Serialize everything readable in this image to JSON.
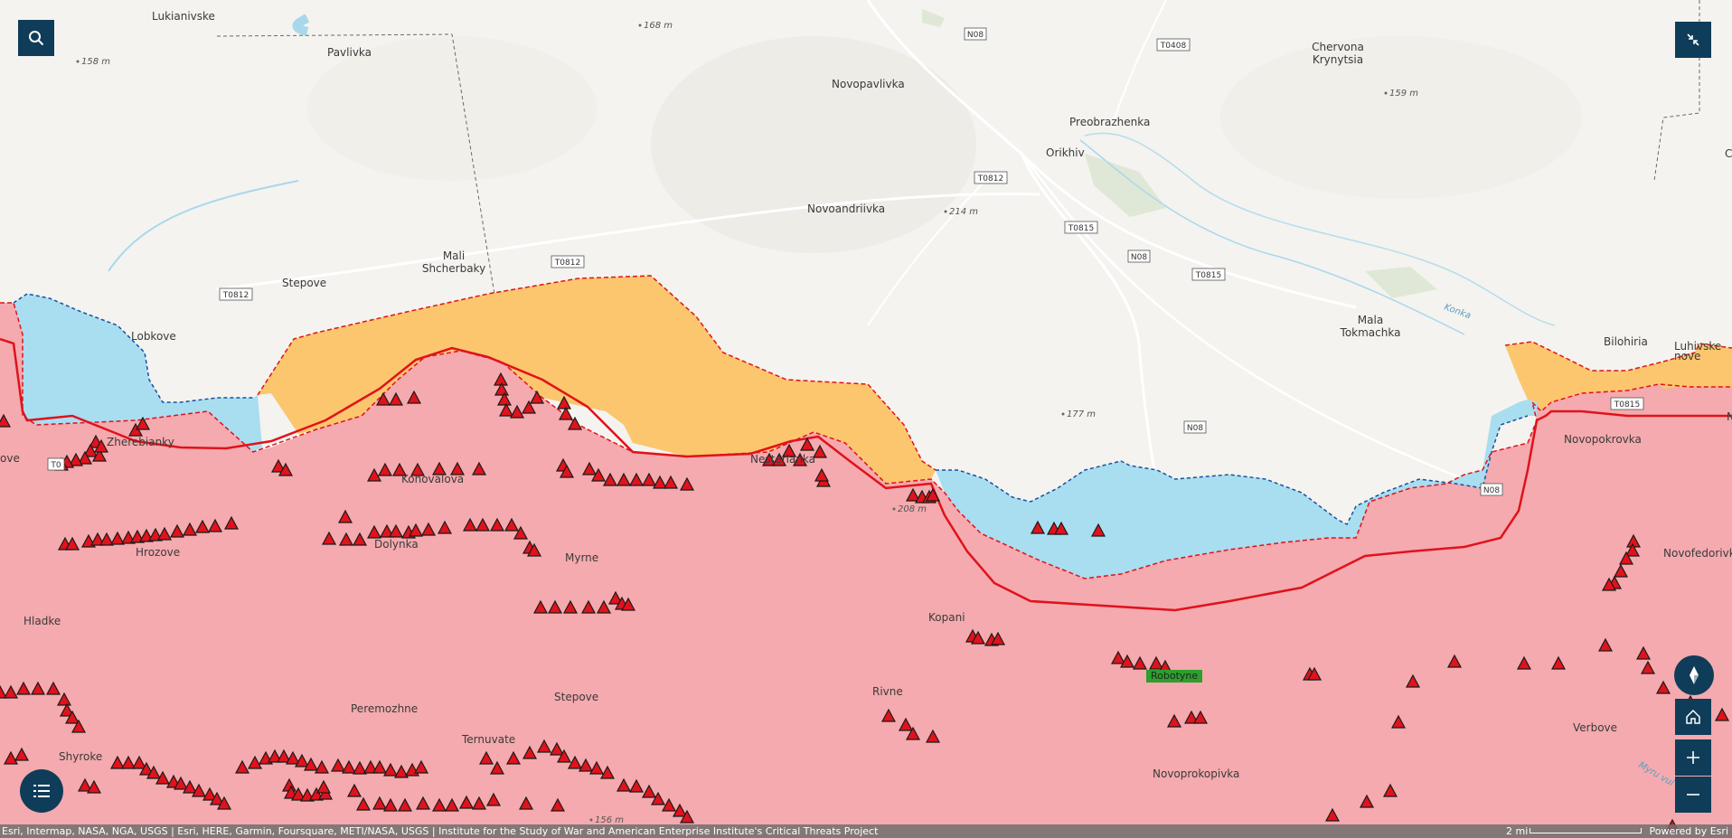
{
  "colors": {
    "occupied": "#f4aaae",
    "contested_orange": "#fbc66d",
    "contested_blue": "#a8def0",
    "frontline": "#e0121c",
    "control_bg": "#0f3d59"
  },
  "places": [
    {
      "id": "lukianivske",
      "name": "Lukianivske"
    },
    {
      "id": "pavlivka",
      "name": "Pavlivka"
    },
    {
      "id": "novopavlivka",
      "name": "Novopavlivka"
    },
    {
      "id": "chervona",
      "name": "Chervona\nKrynytsia"
    },
    {
      "id": "preobrazhenka",
      "name": "Preobrazhenka"
    },
    {
      "id": "orikhiv",
      "name": "Orikhiv"
    },
    {
      "id": "novoandriivka",
      "name": "Novoandriivka"
    },
    {
      "id": "mali",
      "name": "Mali\nShcherbaky"
    },
    {
      "id": "stepove1",
      "name": "Stepove"
    },
    {
      "id": "lobkove",
      "name": "Lobkove"
    },
    {
      "id": "mala",
      "name": "Mala\nTokmachka"
    },
    {
      "id": "bilohiria",
      "name": "Bilohiria"
    },
    {
      "id": "luhivske",
      "name": "Luhivske"
    },
    {
      "id": "zherebianky",
      "name": "Zherebianky"
    },
    {
      "id": "konovalova",
      "name": "Konovalova"
    },
    {
      "id": "nesterianka",
      "name": "Nesterianka"
    },
    {
      "id": "novopokrovka",
      "name": "Novopokrovka"
    },
    {
      "id": "dolynka",
      "name": "Dolynka"
    },
    {
      "id": "hrozove",
      "name": "Hrozove"
    },
    {
      "id": "myrne",
      "name": "Myrne"
    },
    {
      "id": "novofedorivka",
      "name": "Novofedorivka"
    },
    {
      "id": "hladke",
      "name": "Hladke"
    },
    {
      "id": "kopani",
      "name": "Kopani"
    },
    {
      "id": "peremozhne",
      "name": "Peremozhne"
    },
    {
      "id": "stepove2",
      "name": "Stepove"
    },
    {
      "id": "rivne",
      "name": "Rivne"
    },
    {
      "id": "verbove",
      "name": "Verbove"
    },
    {
      "id": "shyroke",
      "name": "Shyroke"
    },
    {
      "id": "ternuvate",
      "name": "Ternuvate"
    },
    {
      "id": "novoprokopivka",
      "name": "Novoprokopivka"
    },
    {
      "id": "ove",
      "name": "ove"
    },
    {
      "id": "nove",
      "name": "nove"
    },
    {
      "id": "edge_c",
      "name": "C"
    },
    {
      "id": "edge_n",
      "name": "N"
    }
  ],
  "elevations": [
    "168 m",
    "158 m",
    "159 m",
    "214 m",
    "177 m",
    "208 m",
    "156 m"
  ],
  "roads": [
    "N08",
    "T0408",
    "T0812",
    "T0815",
    "T0"
  ],
  "rivers": [
    "Konka",
    "Myru vul"
  ],
  "highlight": "Robotyne",
  "attribution": {
    "left": "Esri, Intermap, NASA, NGA, USGS | Esri, HERE, Garmin, Foursquare, METI/NASA, USGS | Institute for the Study of War and American Enterprise Institute's Critical Threats Project",
    "scale": "2 mi",
    "powered": "Powered by Esri"
  },
  "controls": {
    "search": "search-icon",
    "collapse": "collapse-icon",
    "compass": "compass-icon",
    "home": "home-icon",
    "zoom_in": "plus-icon",
    "zoom_out": "minus-icon",
    "legend": "list-icon"
  }
}
